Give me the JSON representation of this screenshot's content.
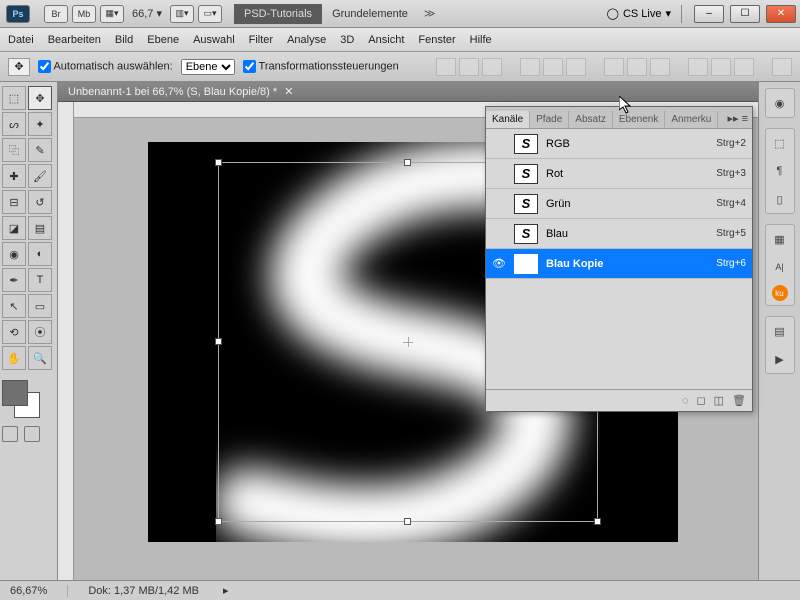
{
  "title": {
    "ps": "Ps",
    "br": "Br",
    "mb": "Mb",
    "zoom": "66,7",
    "tab_dark": "PSD-Tutorials",
    "tab_light": "Grundelemente",
    "cslive": "CS Live"
  },
  "menu": [
    "Datei",
    "Bearbeiten",
    "Bild",
    "Ebene",
    "Auswahl",
    "Filter",
    "Analyse",
    "3D",
    "Ansicht",
    "Fenster",
    "Hilfe"
  ],
  "opt": {
    "auto": "Automatisch auswählen:",
    "level": "Ebene",
    "trans": "Transformationssteuerungen"
  },
  "doc_tab": "Unbenannt-1 bei 66,7% (S, Blau Kopie/8) *",
  "panel": {
    "tabs": [
      "Kanäle",
      "Pfade",
      "Absatz",
      "Ebenenk",
      "Anmerku"
    ],
    "rows": [
      {
        "name": "RGB",
        "sc": "Strg+2",
        "vis": false,
        "sel": false
      },
      {
        "name": "Rot",
        "sc": "Strg+3",
        "vis": false,
        "sel": false
      },
      {
        "name": "Grün",
        "sc": "Strg+4",
        "vis": false,
        "sel": false
      },
      {
        "name": "Blau",
        "sc": "Strg+5",
        "vis": false,
        "sel": false
      },
      {
        "name": "Blau Kopie",
        "sc": "Strg+6",
        "vis": true,
        "sel": true
      }
    ]
  },
  "status": {
    "zoom": "66,67%",
    "doc": "Dok: 1,37 MB/1,42 MB"
  }
}
